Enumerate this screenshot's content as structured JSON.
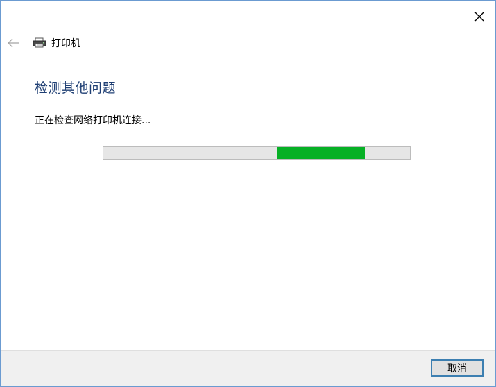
{
  "window": {
    "nav_title": "打印机"
  },
  "main": {
    "heading": "检测其他问题",
    "status": "正在检查网络打印机连接..."
  },
  "progress": {
    "indeterminate": true,
    "fill_color": "#06b025"
  },
  "footer": {
    "cancel_label": "取消"
  },
  "icons": {
    "close": "close-icon",
    "back": "back-arrow-icon",
    "printer": "printer-icon"
  }
}
